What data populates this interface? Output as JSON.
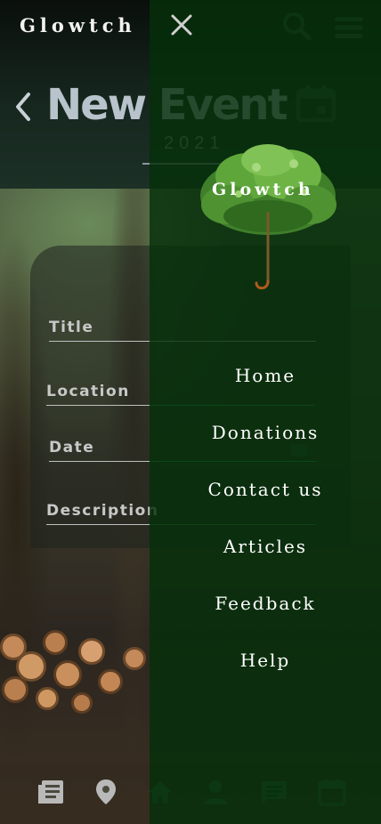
{
  "background_page": {
    "brand": "Glowtch",
    "title": "New Event",
    "year": "2021",
    "form": {
      "title_label": "Title",
      "location_label": "Location",
      "date_label": "Date",
      "description_label": "Description"
    },
    "bottom_nav": [
      "articles-icon",
      "location-pin-icon",
      "home-icon",
      "profile-icon",
      "chat-icon",
      "calendar-icon"
    ]
  },
  "drawer": {
    "brand": "Glowtch",
    "items": [
      {
        "label": "Home"
      },
      {
        "label": "Donations"
      },
      {
        "label": "Contact us"
      },
      {
        "label": "Articles"
      },
      {
        "label": "Feedback"
      },
      {
        "label": "Help"
      }
    ]
  },
  "colors": {
    "drawer_green": "#05300a",
    "text_white": "#ffffff",
    "title_grey": "#b8c3cc"
  }
}
